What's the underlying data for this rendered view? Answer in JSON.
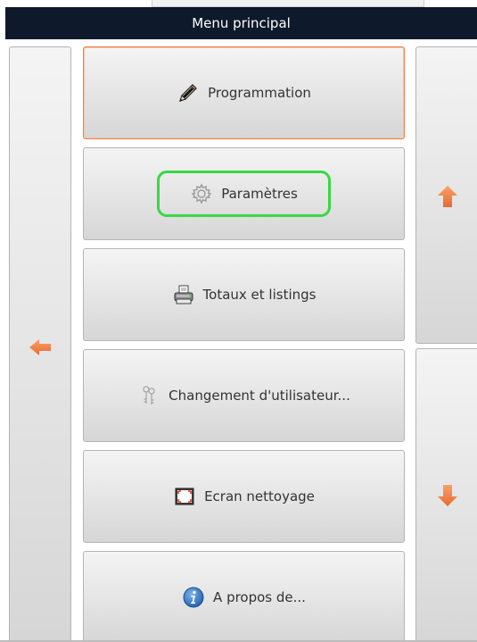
{
  "window": {
    "title": "Menu principal"
  },
  "menu": {
    "items": [
      {
        "label": "Programmation",
        "icon": "pencil-icon"
      },
      {
        "label": "Paramètres",
        "icon": "gear-icon"
      },
      {
        "label": "Totaux et listings",
        "icon": "printer-icon"
      },
      {
        "label": "Changement d'utilisateur...",
        "icon": "keys-icon"
      },
      {
        "label": "Ecran nettoyage",
        "icon": "screen-clean-icon"
      },
      {
        "label": "A propos de...",
        "icon": "info-icon"
      }
    ],
    "selected_index": 0,
    "focused_index": 1
  },
  "navigation": {
    "back_icon": "arrow-left-icon",
    "scroll_up_icon": "arrow-up-icon",
    "scroll_down_icon": "arrow-down-icon"
  },
  "colors": {
    "title_bar": "#0e1a2b",
    "arrow": "#f07f45",
    "selected_border": "#f07f45",
    "focus_ring": "#39d845"
  }
}
